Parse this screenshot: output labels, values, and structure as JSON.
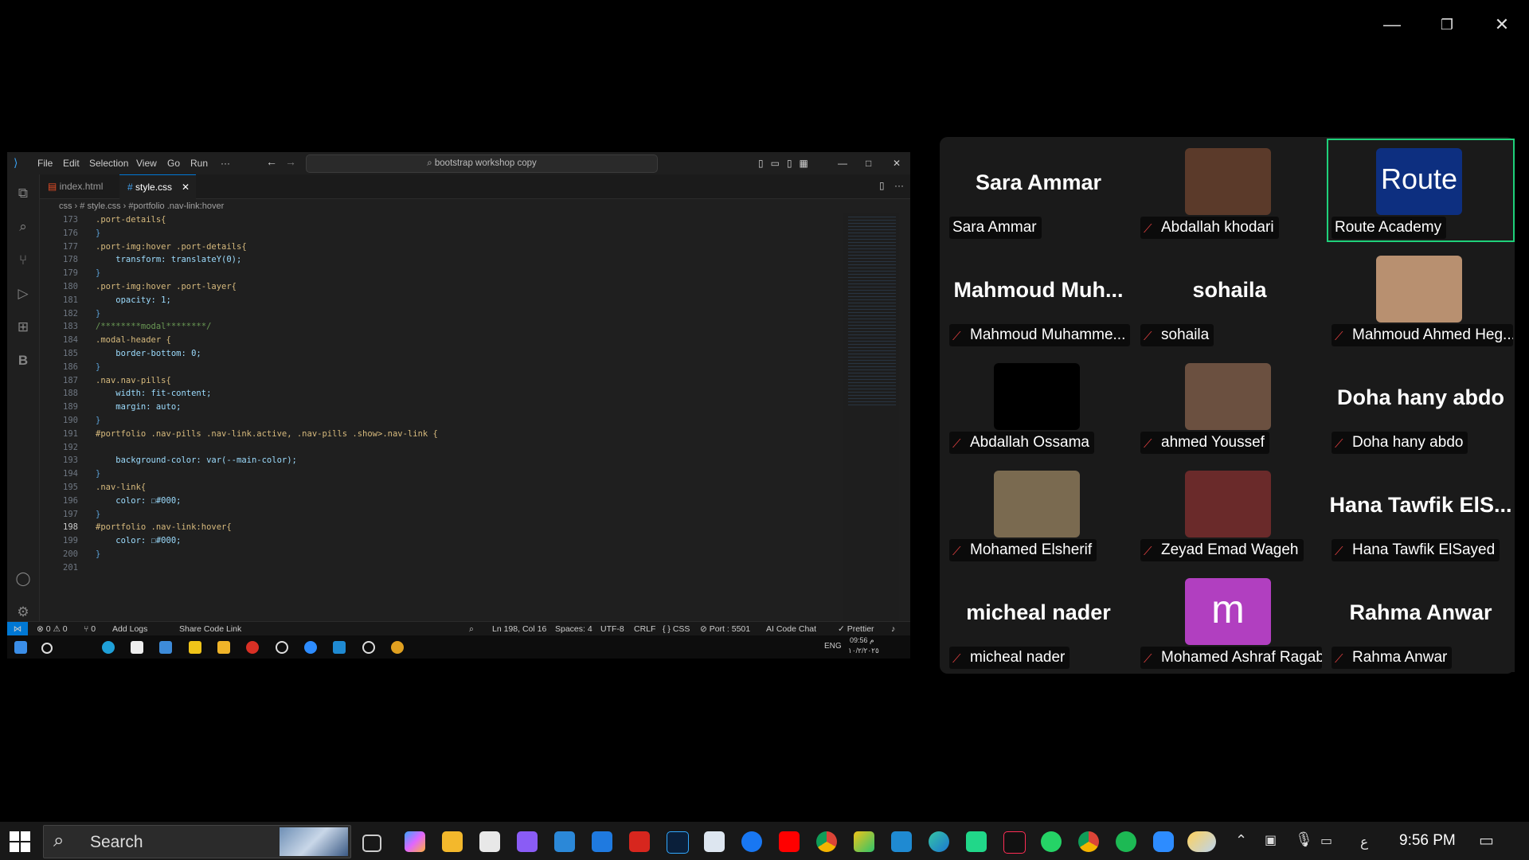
{
  "window_controls": {
    "minimize": "—",
    "restore": "❐",
    "close": "✕"
  },
  "vscode": {
    "menu": [
      "File",
      "Edit",
      "Selection",
      "View",
      "Go",
      "Run",
      "···"
    ],
    "command_center": "bootstrap workshop copy",
    "tabs": [
      {
        "label": "index.html",
        "active": false
      },
      {
        "label": "style.css",
        "active": true
      }
    ],
    "breadcrumb": "css  ›  # style.css  ›  #portfolio .nav-link:hover",
    "lines": [
      {
        "n": "173",
        "code": ".port-details{"
      },
      {
        "n": "176",
        "code": "}"
      },
      {
        "n": "177",
        "code": ".port-img:hover .port-details{"
      },
      {
        "n": "178",
        "code": "    transform: translateY(0);"
      },
      {
        "n": "179",
        "code": "}"
      },
      {
        "n": "180",
        "code": ".port-img:hover .port-layer{"
      },
      {
        "n": "181",
        "code": "    opacity: 1;"
      },
      {
        "n": "182",
        "code": "}"
      },
      {
        "n": "183",
        "code": "/********modal********/"
      },
      {
        "n": "184",
        "code": ".modal-header {"
      },
      {
        "n": "185",
        "code": "    border-bottom: 0;"
      },
      {
        "n": "186",
        "code": "}"
      },
      {
        "n": "187",
        "code": ".nav.nav-pills{"
      },
      {
        "n": "188",
        "code": "    width: fit-content;"
      },
      {
        "n": "189",
        "code": "    margin: auto;"
      },
      {
        "n": "190",
        "code": "}"
      },
      {
        "n": "191",
        "code": "#portfolio .nav-pills .nav-link.active, .nav-pills .show>.nav-link {"
      },
      {
        "n": "192",
        "code": ""
      },
      {
        "n": "193",
        "code": "    background-color: var(--main-color);"
      },
      {
        "n": "194",
        "code": "}"
      },
      {
        "n": "195",
        "code": ".nav-link{"
      },
      {
        "n": "196",
        "code": "    color: ☐#000;"
      },
      {
        "n": "197",
        "code": "}"
      },
      {
        "n": "198",
        "code": "#portfolio .nav-link:hover{"
      },
      {
        "n": "199",
        "code": "    color: ☐#000;"
      },
      {
        "n": "200",
        "code": "}"
      },
      {
        "n": "201",
        "code": ""
      }
    ],
    "status": {
      "errors": "⊗ 0 ⚠ 0",
      "ports": "⑂ 0",
      "add_logs": "Add Logs",
      "share": "Share Code Link",
      "position": "Ln 198, Col 16",
      "spaces": "Spaces: 4",
      "encoding": "UTF-8",
      "eol": "CRLF",
      "lang": "{ } CSS",
      "port": "⊘ Port : 5501",
      "ai": "AI Code Chat",
      "prettier": "✓ Prettier"
    },
    "remote_taskbar": {
      "lang": "ENG",
      "time": "09:56 م",
      "date": "١٠/٢/٢٠٢٥"
    }
  },
  "participants": [
    {
      "display": "Sara Ammar",
      "label": "Sara Ammar",
      "muted": false,
      "video": false
    },
    {
      "display": "",
      "label": "Abdallah khodari",
      "muted": true,
      "video": true,
      "color": "#5b3a2a"
    },
    {
      "display": "",
      "label": "Route Academy",
      "muted": false,
      "video": true,
      "color": "#0d2f80",
      "active": true,
      "logo": "Route"
    },
    {
      "display": "Mahmoud  Muh...",
      "label": "Mahmoud Muhamme...",
      "muted": true,
      "video": false
    },
    {
      "display": "sohaila",
      "label": "sohaila",
      "muted": true,
      "video": false
    },
    {
      "display": "",
      "label": "Mahmoud Ahmed Heg...",
      "muted": true,
      "video": true,
      "color": "#b89070"
    },
    {
      "display": "",
      "label": "Abdallah Ossama",
      "muted": true,
      "video": true,
      "color": "#000000"
    },
    {
      "display": "",
      "label": "ahmed Youssef",
      "muted": true,
      "video": true,
      "color": "#6b5040"
    },
    {
      "display": "Doha hany abdo",
      "label": "Doha hany abdo",
      "muted": true,
      "video": false
    },
    {
      "display": "",
      "label": "Mohamed Elsherif",
      "muted": true,
      "video": true,
      "color": "#7a6a50"
    },
    {
      "display": "",
      "label": "Zeyad Emad Wageh",
      "muted": true,
      "video": true,
      "color": "#6a2a2a"
    },
    {
      "display": "Hana Tawfik  ElS...",
      "label": "Hana Tawfik ElSayed",
      "muted": true,
      "video": false
    },
    {
      "display": "micheal nader",
      "label": "micheal nader",
      "muted": true,
      "video": false
    },
    {
      "display": "",
      "label": "Mohamed Ashraf Ragab",
      "muted": true,
      "video": true,
      "color": "#b13fc0",
      "logo": "m"
    },
    {
      "display": "Rahma Anwar",
      "label": "Rahma Anwar",
      "muted": true,
      "video": false
    }
  ],
  "taskbar": {
    "search_placeholder": "Search",
    "time": "9:56 PM",
    "lang": "ع"
  },
  "colors": {
    "active_speaker": "#1fd07a",
    "mute": "#e04040",
    "vscode_blue": "#0078d4"
  }
}
